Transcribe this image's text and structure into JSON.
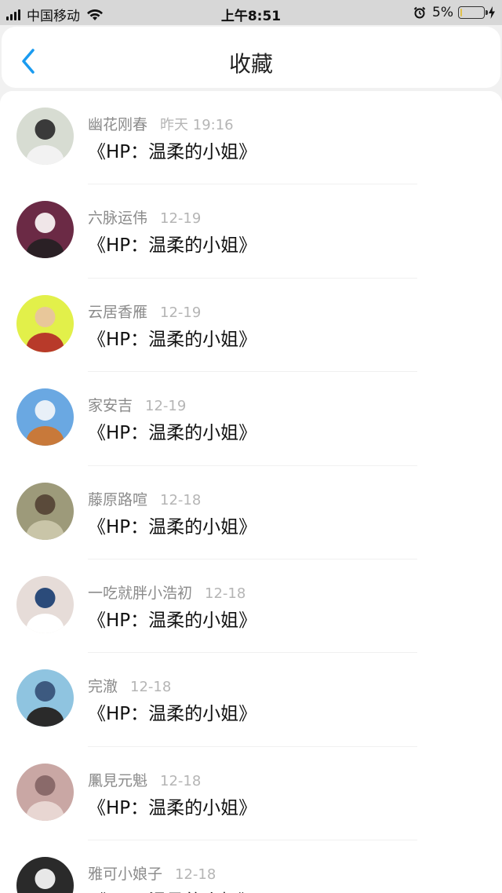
{
  "status_bar": {
    "carrier": "中国移动",
    "time": "上午8:51",
    "battery_percent": "5%",
    "battery_level": 0.05,
    "icons": [
      "signal-icon",
      "wifi-icon",
      "alarm-icon",
      "battery-icon",
      "charging-icon"
    ]
  },
  "nav": {
    "title": "收藏",
    "back_icon": "chevron-left-icon",
    "accent_color": "#1a9bf0"
  },
  "items": [
    {
      "user": "幽花刚春",
      "time": "昨天 19:16",
      "title": "《HP：温柔的小姐》",
      "avatar_colors": [
        "#d7dcd2",
        "#3a3a3a",
        "#f2f2f2"
      ]
    },
    {
      "user": "六脉运伟",
      "time": "12-19",
      "title": "《HP：温柔的小姐》",
      "avatar_colors": [
        "#6b2a45",
        "#f0e6e8",
        "#2a2025"
      ]
    },
    {
      "user": "云居香雁",
      "time": "12-19",
      "title": "《HP：温柔的小姐》",
      "avatar_colors": [
        "#e2f04a",
        "#e8c79a",
        "#b83a2a"
      ]
    },
    {
      "user": "家安吉",
      "time": "12-19",
      "title": "《HP：温柔的小姐》",
      "avatar_colors": [
        "#6aa8e2",
        "#e8f0f8",
        "#c8793a"
      ]
    },
    {
      "user": "藤原路喧",
      "time": "12-18",
      "title": "《HP：温柔的小姐》",
      "avatar_colors": [
        "#9d9a7a",
        "#5a4a3a",
        "#c9c5a8"
      ]
    },
    {
      "user": "一吃就胖小浩初",
      "time": "12-18",
      "title": "《HP：温柔的小姐》",
      "avatar_colors": [
        "#e6dcd8",
        "#2b4b7a",
        "#ffffff"
      ]
    },
    {
      "user": "完澈",
      "time": "12-18",
      "title": "《HP：温柔的小姐》",
      "avatar_colors": [
        "#8fc4e0",
        "#3d5a80",
        "#2a2a2a"
      ]
    },
    {
      "user": "凲見元魁",
      "time": "12-18",
      "title": "《HP：温柔的小姐》",
      "avatar_colors": [
        "#c9a7a4",
        "#8a6a6a",
        "#e8d6d2"
      ]
    },
    {
      "user": "雅可小娘子",
      "time": "12-18",
      "title": "《HP：温柔的小姐》",
      "avatar_colors": [
        "#2a2a2a",
        "#e8e8e8",
        "#555555"
      ]
    }
  ]
}
